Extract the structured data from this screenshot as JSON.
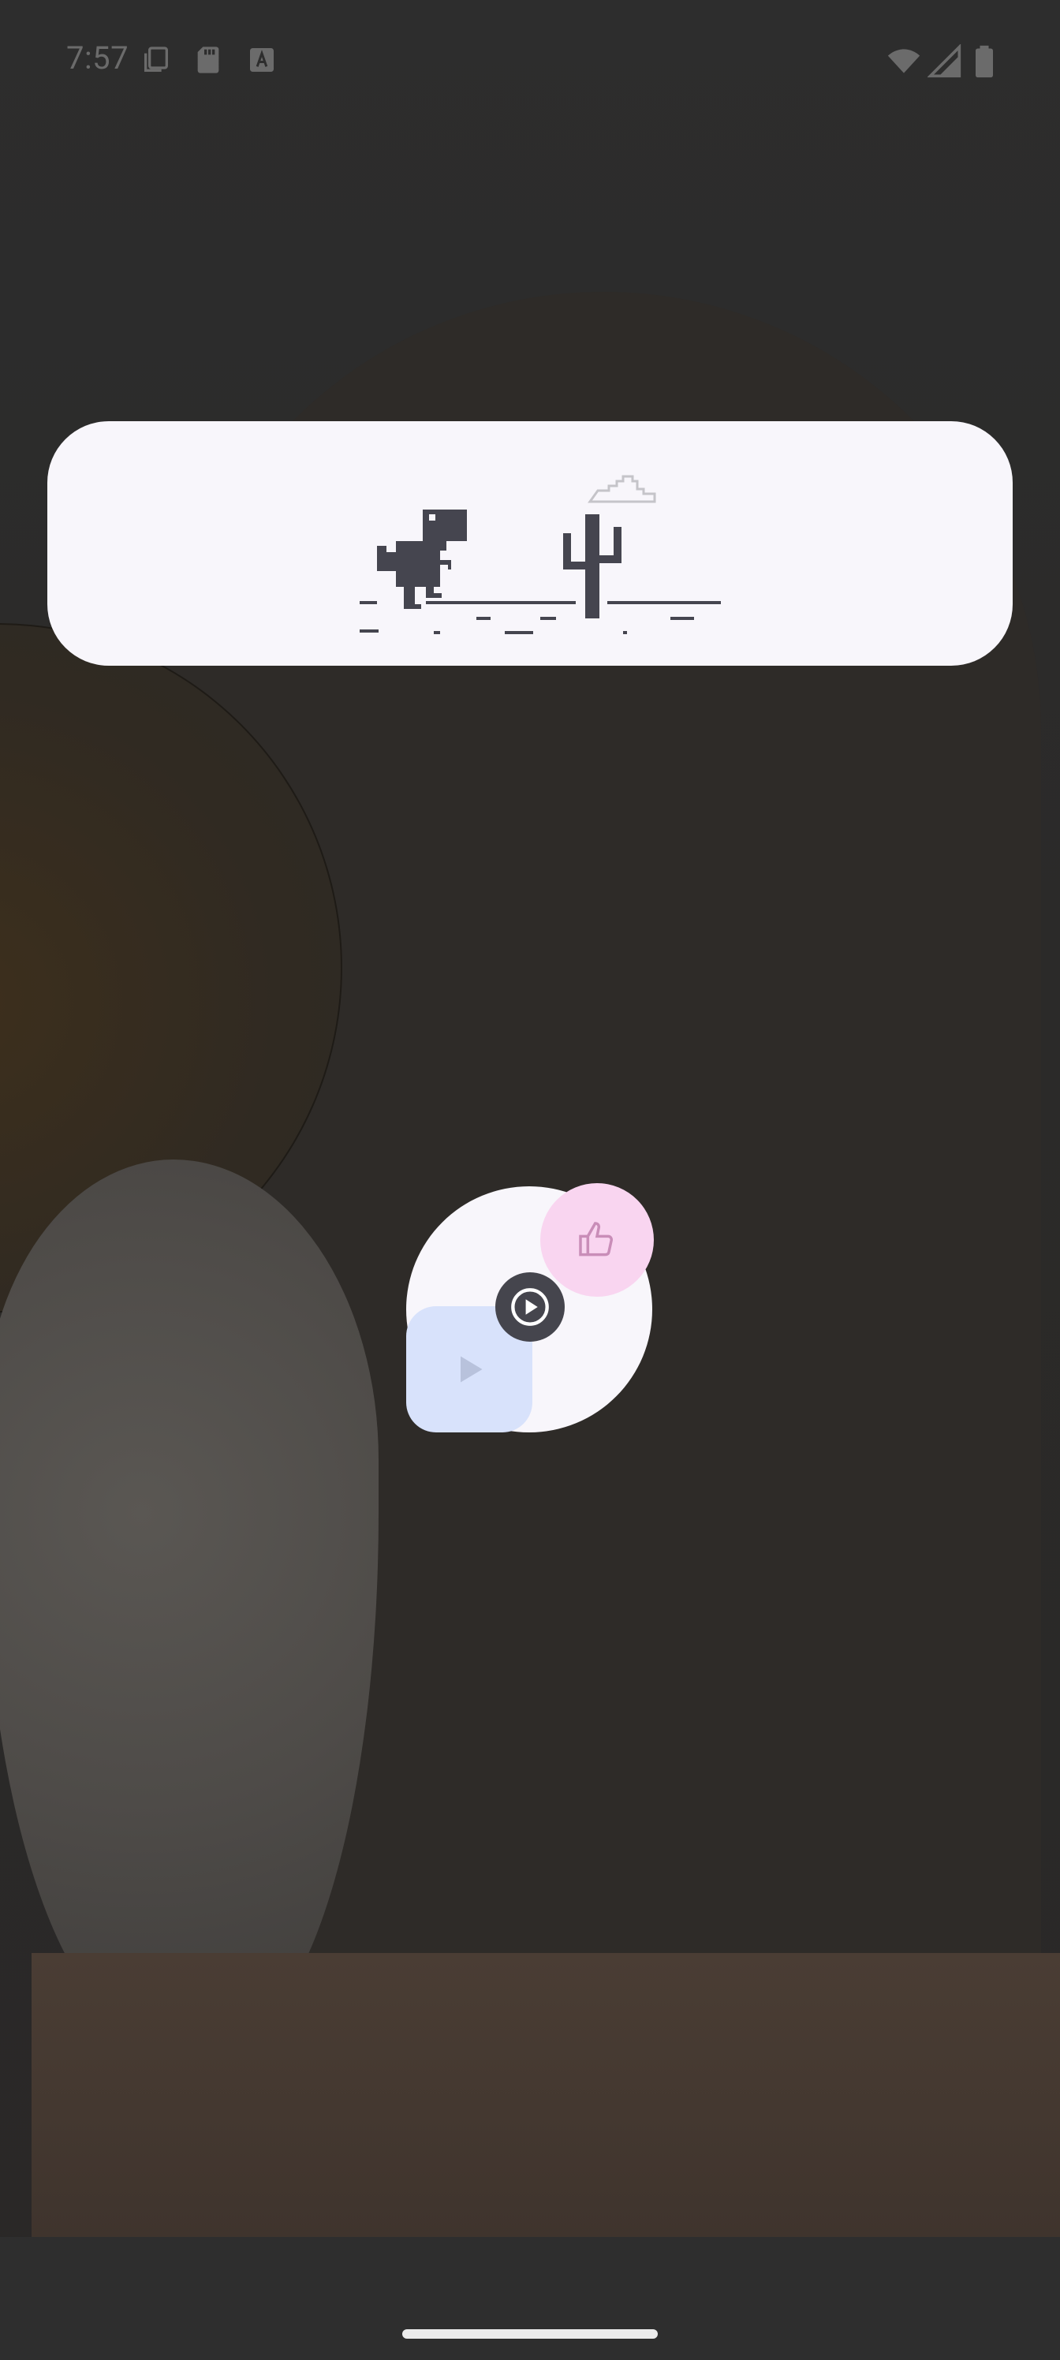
{
  "status_bar": {
    "time": "7:57",
    "left_icons": [
      "copy-icon",
      "sd-card-icon",
      "a-badge-icon"
    ],
    "right_icons": [
      "wifi-icon",
      "cellular-signal-icon",
      "battery-icon"
    ]
  },
  "widgets": {
    "dino_game": {
      "icon": "chrome-dino-icon"
    },
    "shortcut_cluster": {
      "icons": [
        "thumbs-up-icon",
        "play-circle-icon",
        "play-icon"
      ],
      "colors": {
        "pink": "#f9d5f0",
        "blue": "#d8e2fb",
        "center": "#45454d"
      }
    }
  },
  "colors": {
    "card_bg": "#f8f6fb",
    "dino": "#45454f",
    "wallpaper": "#2b2a29"
  }
}
